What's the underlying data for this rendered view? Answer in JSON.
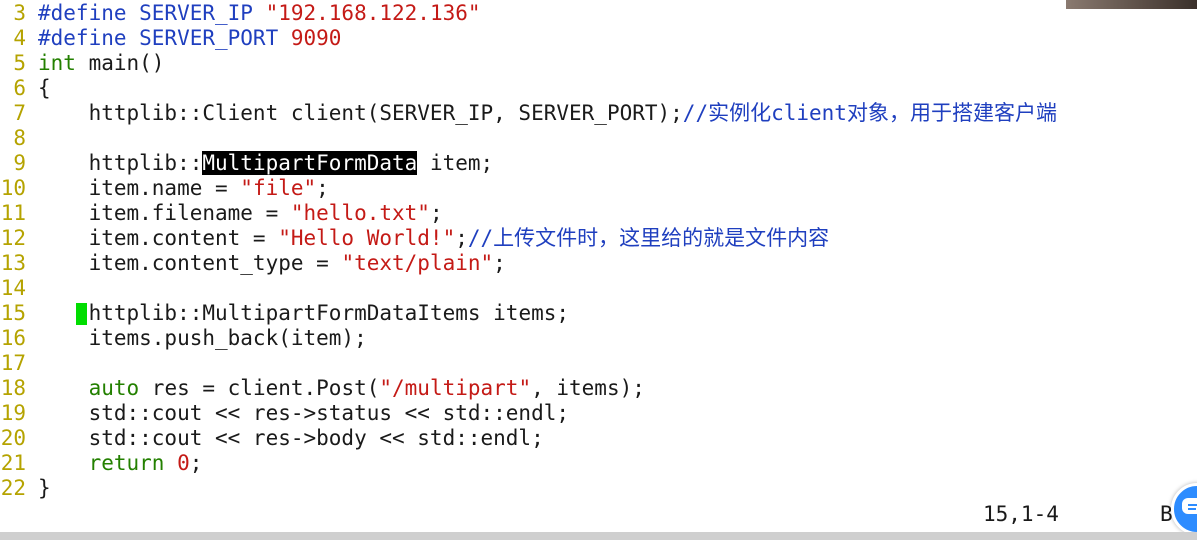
{
  "editor": {
    "lines": [
      {
        "num": "3",
        "segments": [
          {
            "t": "#define SERVER_IP ",
            "c": "kw-pre"
          },
          {
            "t": "\"192.168.122.136\"",
            "c": "str"
          }
        ]
      },
      {
        "num": "4",
        "segments": [
          {
            "t": "#define SERVER_PORT ",
            "c": "kw-pre"
          },
          {
            "t": "9090",
            "c": "num"
          }
        ]
      },
      {
        "num": "5",
        "segments": [
          {
            "t": "int",
            "c": "type"
          },
          {
            "t": " main()",
            "c": ""
          }
        ]
      },
      {
        "num": "6",
        "segments": [
          {
            "t": "{",
            "c": ""
          }
        ]
      },
      {
        "num": "7",
        "segments": [
          {
            "t": "    httplib::Client client(SERVER_IP, SERVER_PORT);",
            "c": ""
          },
          {
            "t": "//实例化client对象，用于搭建客户端",
            "c": "comment"
          }
        ]
      },
      {
        "num": "8",
        "segments": []
      },
      {
        "num": "9",
        "segments": [
          {
            "t": "    httplib::",
            "c": ""
          },
          {
            "t": "MultipartFormData",
            "c": "hl"
          },
          {
            "t": " item;",
            "c": ""
          }
        ]
      },
      {
        "num": "10",
        "segments": [
          {
            "t": "    item.name = ",
            "c": ""
          },
          {
            "t": "\"file\"",
            "c": "str"
          },
          {
            "t": ";",
            "c": ""
          }
        ]
      },
      {
        "num": "11",
        "segments": [
          {
            "t": "    item.filename = ",
            "c": ""
          },
          {
            "t": "\"hello.txt\"",
            "c": "str"
          },
          {
            "t": ";",
            "c": ""
          }
        ]
      },
      {
        "num": "12",
        "segments": [
          {
            "t": "    item.content = ",
            "c": ""
          },
          {
            "t": "\"Hello World!\"",
            "c": "str"
          },
          {
            "t": ";",
            "c": ""
          },
          {
            "t": "//上传文件时，这里给的就是文件内容",
            "c": "comment"
          }
        ]
      },
      {
        "num": "13",
        "segments": [
          {
            "t": "    item.content_type = ",
            "c": ""
          },
          {
            "t": "\"text/plain\"",
            "c": "str"
          },
          {
            "t": ";",
            "c": ""
          }
        ]
      },
      {
        "num": "14",
        "segments": []
      },
      {
        "num": "15",
        "segments": [
          {
            "t": "    ",
            "c": ""
          },
          {
            "t": "",
            "c": "cursor"
          },
          {
            "t": "httplib::MultipartFormDataItems items;",
            "c": ""
          }
        ]
      },
      {
        "num": "16",
        "segments": [
          {
            "t": "    items.push_back(item);",
            "c": ""
          }
        ]
      },
      {
        "num": "17",
        "segments": []
      },
      {
        "num": "18",
        "segments": [
          {
            "t": "    ",
            "c": ""
          },
          {
            "t": "auto",
            "c": "type"
          },
          {
            "t": " res = client.Post(",
            "c": ""
          },
          {
            "t": "\"/multipart\"",
            "c": "str"
          },
          {
            "t": ", items);",
            "c": ""
          }
        ]
      },
      {
        "num": "19",
        "segments": [
          {
            "t": "    std::cout << res->status << std::endl;",
            "c": ""
          }
        ]
      },
      {
        "num": "20",
        "segments": [
          {
            "t": "    std::cout << res->body << std::endl;",
            "c": ""
          }
        ]
      },
      {
        "num": "21",
        "segments": [
          {
            "t": "    ",
            "c": ""
          },
          {
            "t": "return",
            "c": "type"
          },
          {
            "t": " ",
            "c": ""
          },
          {
            "t": "0",
            "c": "num"
          },
          {
            "t": ";",
            "c": ""
          }
        ]
      },
      {
        "num": "22",
        "segments": [
          {
            "t": "}",
            "c": ""
          }
        ]
      }
    ]
  },
  "status": {
    "position": "15,1-4",
    "scroll": "B"
  }
}
